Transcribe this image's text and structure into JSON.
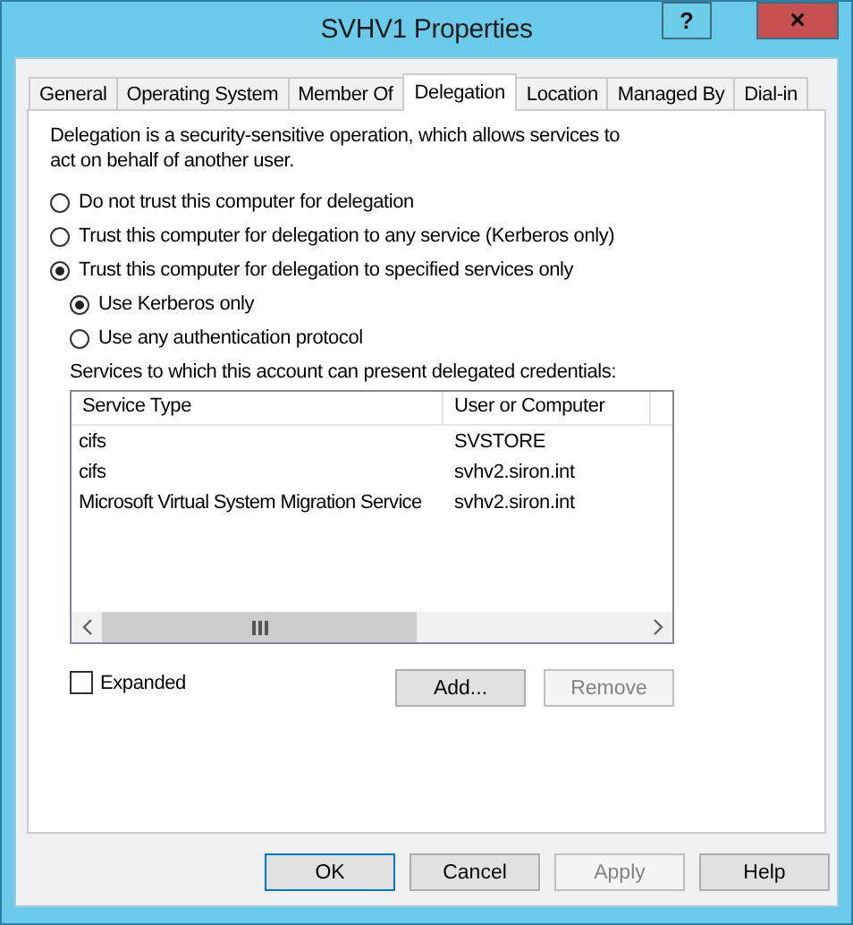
{
  "window": {
    "title": "SVHV1 Properties",
    "help_button": "?",
    "close_button": "×"
  },
  "tabs": [
    {
      "label": "General",
      "selected": false
    },
    {
      "label": "Operating System",
      "selected": false
    },
    {
      "label": "Member Of",
      "selected": false
    },
    {
      "label": "Delegation",
      "selected": true
    },
    {
      "label": "Location",
      "selected": false
    },
    {
      "label": "Managed By",
      "selected": false
    },
    {
      "label": "Dial-in",
      "selected": false
    }
  ],
  "description": "Delegation is a security-sensitive operation, which allows services to act on behalf of another user.",
  "delegation_options": [
    {
      "label": "Do not trust this computer for delegation",
      "selected": false
    },
    {
      "label": "Trust this computer for delegation to any service (Kerberos only)",
      "selected": false
    },
    {
      "label": "Trust this computer for delegation to specified services only",
      "selected": true
    }
  ],
  "protocol_options": [
    {
      "label": "Use Kerberos only",
      "selected": true
    },
    {
      "label": "Use any authentication protocol",
      "selected": false
    }
  ],
  "services_label": "Services to which this account can present delegated credentials:",
  "table": {
    "columns": [
      "Service Type",
      "User or Computer"
    ],
    "rows": [
      [
        "cifs",
        "SVSTORE"
      ],
      [
        "cifs",
        "svhv2.siron.int"
      ],
      [
        "Microsoft Virtual System Migration Service",
        "svhv2.siron.int"
      ]
    ]
  },
  "expanded": {
    "label": "Expanded",
    "checked": false
  },
  "list_buttons": [
    {
      "label": "Add...",
      "disabled": false
    },
    {
      "label": "Remove",
      "disabled": true
    }
  ],
  "buttons": [
    {
      "label": "OK",
      "default": true,
      "disabled": false
    },
    {
      "label": "Cancel",
      "default": false,
      "disabled": false
    },
    {
      "label": "Apply",
      "default": false,
      "disabled": true
    },
    {
      "label": "Help",
      "default": false,
      "disabled": false
    }
  ]
}
